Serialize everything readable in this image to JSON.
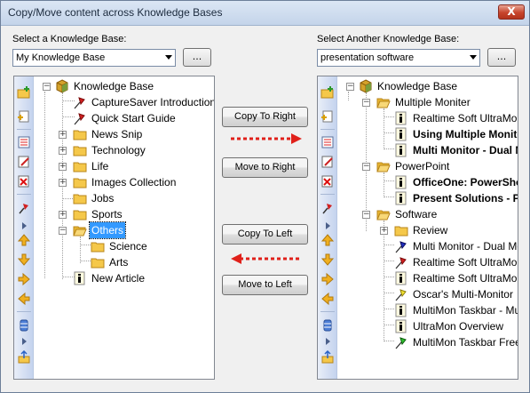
{
  "window": {
    "title": "Copy/Move content across Knowledge Bases",
    "close_label": "X"
  },
  "left": {
    "label": "Select a Knowledge Base:",
    "combo_value": "My Knowledge Base",
    "browse_label": "..."
  },
  "right": {
    "label": "Select Another Knowledge Base:",
    "combo_value": "presentation software",
    "browse_label": "..."
  },
  "buttons": {
    "copy_right": "Copy To Right",
    "move_right": "Move to Right",
    "copy_left": "Copy To Left",
    "move_left": "Move to Left"
  },
  "left_tree": {
    "root": "Knowledge Base",
    "items": [
      {
        "label": "CaptureSaver Introduction",
        "icon": "red-pushpin-icon"
      },
      {
        "label": "Quick Start Guide",
        "icon": "red-pushpin-icon"
      },
      {
        "label": "News Snip",
        "icon": "folder-icon"
      },
      {
        "label": "Technology",
        "icon": "folder-icon"
      },
      {
        "label": "Life",
        "icon": "folder-icon"
      },
      {
        "label": "Images Collection",
        "icon": "folder-icon"
      },
      {
        "label": "Jobs",
        "icon": "folder-icon"
      },
      {
        "label": "Sports",
        "icon": "folder-icon"
      },
      {
        "label": "Others",
        "icon": "folder-open-icon"
      },
      {
        "label": "Science",
        "icon": "folder-icon"
      },
      {
        "label": "Arts",
        "icon": "folder-icon"
      },
      {
        "label": "New Article",
        "icon": "info-document-icon"
      }
    ]
  },
  "right_tree": {
    "root": "Knowledge Base",
    "items": [
      {
        "label": "Multiple Moniter",
        "icon": "folder-open-icon"
      },
      {
        "label": "Realtime Soft UltraMon",
        "icon": "info-document-icon"
      },
      {
        "label": "Using Multiple Monitors",
        "icon": "info-document-icon"
      },
      {
        "label": "Multi Monitor - Dual Monitor",
        "icon": "info-document-icon"
      },
      {
        "label": "PowerPoint",
        "icon": "folder-open-icon"
      },
      {
        "label": "OfficeOne: PowerShow",
        "icon": "info-document-icon"
      },
      {
        "label": "Present Solutions - Pro",
        "icon": "info-document-icon"
      },
      {
        "label": "Software",
        "icon": "folder-open-icon"
      },
      {
        "label": "Review",
        "icon": "folder-icon"
      },
      {
        "label": "Multi Monitor - Dual Monitor",
        "icon": "blue-pushpin-icon"
      },
      {
        "label": "Realtime Soft UltraMon",
        "icon": "red-pushpin-icon"
      },
      {
        "label": "Realtime Soft UltraMon",
        "icon": "info-document-icon"
      },
      {
        "label": "Oscar's Multi-Monitor",
        "icon": "yellow-pushpin-icon"
      },
      {
        "label": "MultiMon Taskbar - Multi",
        "icon": "info-document-icon"
      },
      {
        "label": "UltraMon Overview",
        "icon": "info-document-icon"
      },
      {
        "label": "MultiMon Taskbar Free",
        "icon": "green-pushpin-icon"
      }
    ]
  },
  "colors": {
    "selection": "#3399ff",
    "arrow_red": "#e0201a",
    "folder_yellow": "#f5c84a"
  }
}
